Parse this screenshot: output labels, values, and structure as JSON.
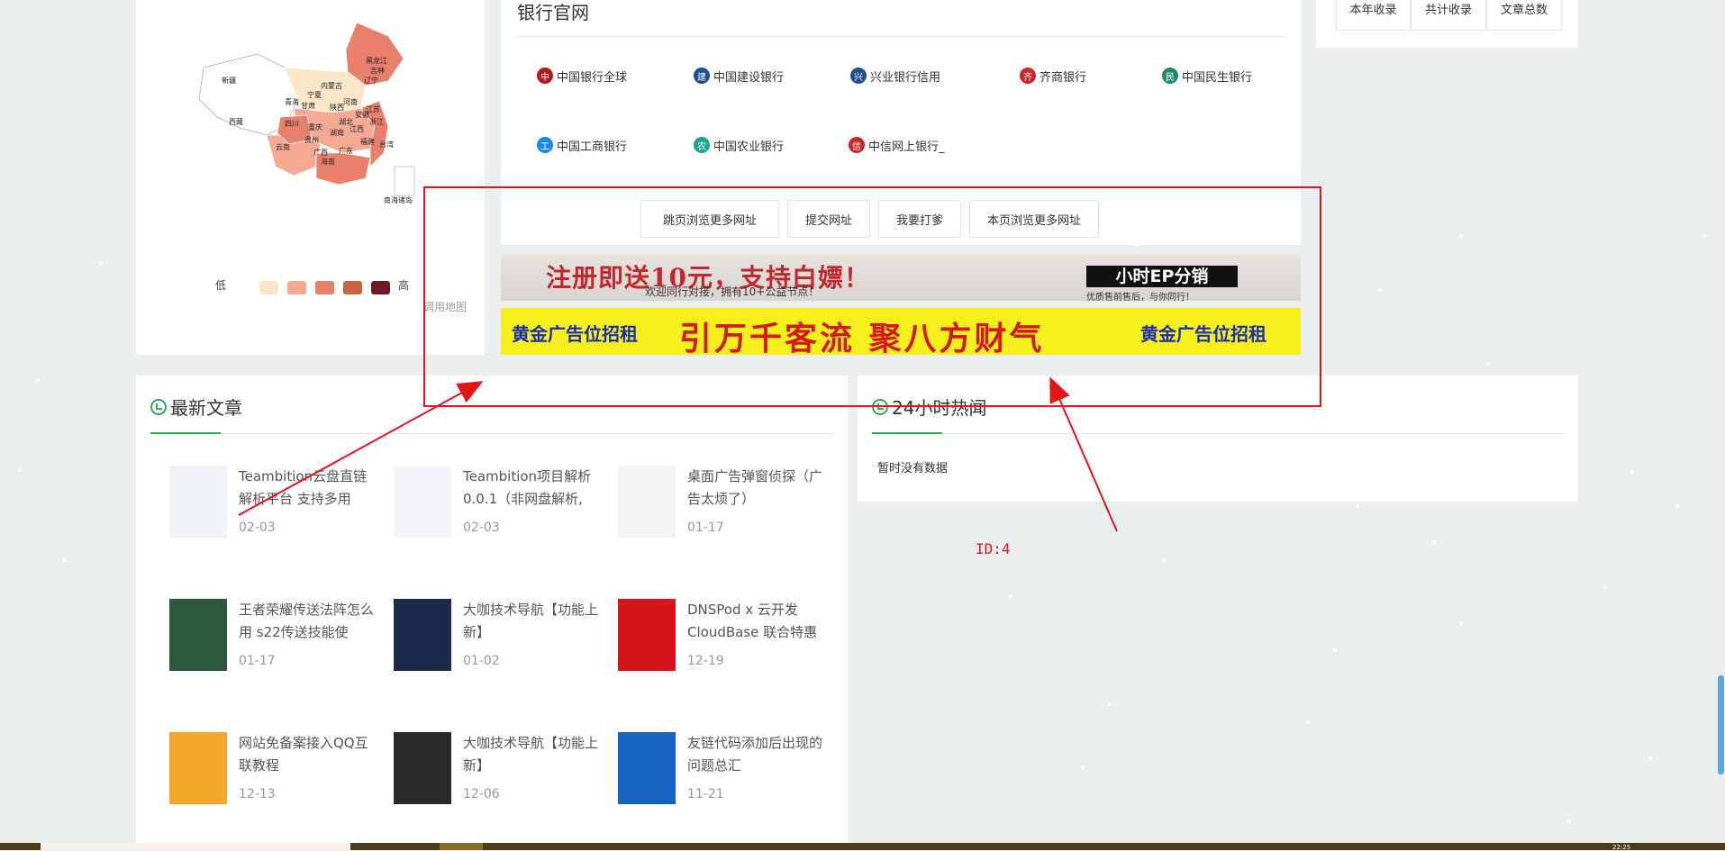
{
  "map": {
    "provinces": {
      "xinjiang": "新疆",
      "xizang": "西藏",
      "heilongjiang": "黑龙江",
      "jilin": "吉林",
      "liaoning": "辽宁",
      "neimenggu": "内蒙古",
      "ningxia": "宁夏",
      "qinghai": "青海",
      "gansu": "甘肃",
      "shaanxi": "陕西",
      "henan": "河南",
      "sichuan": "四川",
      "chongqing": "重庆",
      "hubei": "湖北",
      "anhui": "安徽",
      "jiangsu": "江苏",
      "zhejiang": "浙江",
      "guizhou": "贵州",
      "hunan": "湖南",
      "jiangxi": "江西",
      "fujian": "福建",
      "yunnan": "云南",
      "guangxi": "广西",
      "guangdong": "广东",
      "taiwan": "台湾",
      "hainan": "海南",
      "nanhai": "南海诸岛"
    },
    "legend_low": "低",
    "legend_high": "高",
    "legend_colors": [
      "#fbe7c6",
      "#f4a992",
      "#e9806b",
      "#c9633e",
      "#6e1a22"
    ],
    "link_text": "调用地图"
  },
  "banks": {
    "title": "银行官网",
    "items": [
      {
        "name": "中国银行全球",
        "color": "#b31b1b",
        "icon": "bank-of-china-icon"
      },
      {
        "name": "中国建设银行",
        "color": "#1d4f91",
        "icon": "ccb-icon"
      },
      {
        "name": "兴业银行信用",
        "color": "#1d4f91",
        "icon": "cib-icon"
      },
      {
        "name": "齐商银行",
        "color": "#c62828",
        "icon": "qishang-icon"
      },
      {
        "name": "中国民生银行",
        "color": "#1f8a6b",
        "icon": "cmbc-icon"
      },
      {
        "name": "中国工商银行",
        "color": "#1e88e5",
        "icon": "icbc-icon"
      },
      {
        "name": "中国农业银行",
        "color": "#1aa68a",
        "icon": "abc-icon"
      },
      {
        "name": "中信网上银行_",
        "color": "#c62828",
        "icon": "citic-icon"
      }
    ],
    "buttons": [
      "跳页浏览更多网址",
      "提交网址",
      "我要打爹",
      "本页浏览更多网址"
    ]
  },
  "ads": {
    "ad1_main": "注册即送10元，支持白嫖！",
    "ad1_sub": "欢迎同行对接，拥有10+公益节点！",
    "ad1_box": "小时EP分销",
    "ad1_small": "优质售前售后，与你同行！",
    "ad2_left": "黄金广告位招租",
    "ad2_mid": "引万千客流  聚八方财气",
    "ad2_right": "黄金广告位招租"
  },
  "latest": {
    "title": "最新文章",
    "articles": [
      {
        "title": "Teambition云盘直链解析平台 支持多用",
        "date": "02-03",
        "thumb": "#eef2f6"
      },
      {
        "title": "Teambition项目解析0.0.1（非网盘解析,",
        "date": "02-03",
        "thumb": "#f3f5f8"
      },
      {
        "title": "桌面广告弹窗侦探（广告太烦了）",
        "date": "01-17",
        "thumb": "#f4f4f4"
      },
      {
        "title": "王者荣耀传送法阵怎么用 s22传送技能使",
        "date": "01-17",
        "thumb": "#2d5a3c"
      },
      {
        "title": "大咖技术导航【功能上新】",
        "date": "01-02",
        "thumb": "#1b2a4a"
      },
      {
        "title": "DNSPod x 云开发 CloudBase 联合特惠",
        "date": "12-19",
        "thumb": "#d5141b"
      },
      {
        "title": "网站免备案接入QQ互联教程",
        "date": "12-13",
        "thumb": "#f2a72c"
      },
      {
        "title": "大咖技术导航【功能上新】",
        "date": "12-06",
        "thumb": "#2a2a2a"
      },
      {
        "title": "友链代码添加后出现的问题总汇",
        "date": "11-21",
        "thumb": "#1565c0"
      }
    ]
  },
  "hot": {
    "title": "24小时热闻",
    "empty": "暂时没有数据"
  },
  "stats": {
    "cells": [
      "本年收录",
      "共计收录",
      "文章总数"
    ]
  },
  "annotation": {
    "id_label": "ID:4",
    "color": "#e4141b"
  },
  "clock": "22:25"
}
